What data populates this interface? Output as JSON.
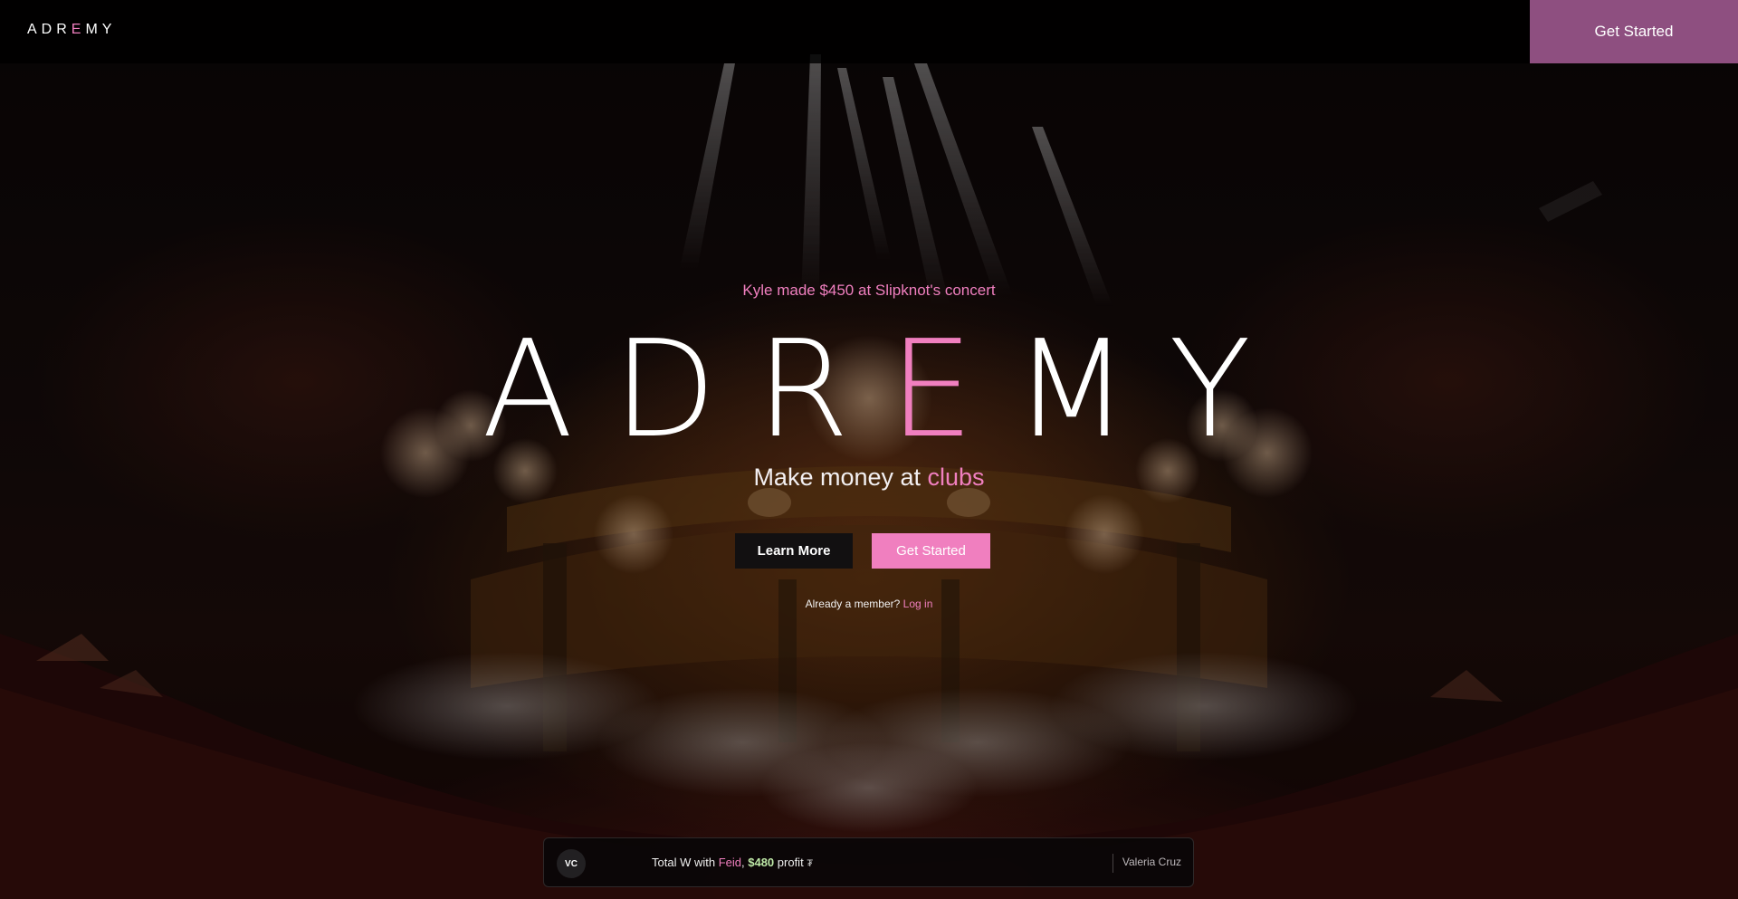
{
  "topbar": {
    "brand_prefix": "ADR",
    "brand_accent": "E",
    "brand_suffix": "MY",
    "cta_label": "Get Started"
  },
  "hero": {
    "tagline": "Kyle made $450 at Slipknot's concert",
    "brand_prefix": "ADR",
    "brand_accent": "E",
    "brand_suffix": "MY",
    "subtitle_prefix": "Make money at ",
    "subtitle_accent": "clubs",
    "learn_more_label": "Learn More",
    "get_started_label": "Get Started",
    "member_text": "Already a member?",
    "login_label": "Log in"
  },
  "ticker": {
    "avatar_initials": "VC",
    "msg_prefix": "Total W with ",
    "artist": "Feid",
    "msg_comma": ",",
    "profit": "$480",
    "msg_suffix": "profit",
    "flag": "₮",
    "user_name": "Valeria Cruz"
  },
  "colors": {
    "accent": "#f07fbf",
    "topbar_cta": "#8e4f80",
    "profit": "#bfe9a8"
  },
  "icons": {
    "flag": "flag-icon"
  }
}
